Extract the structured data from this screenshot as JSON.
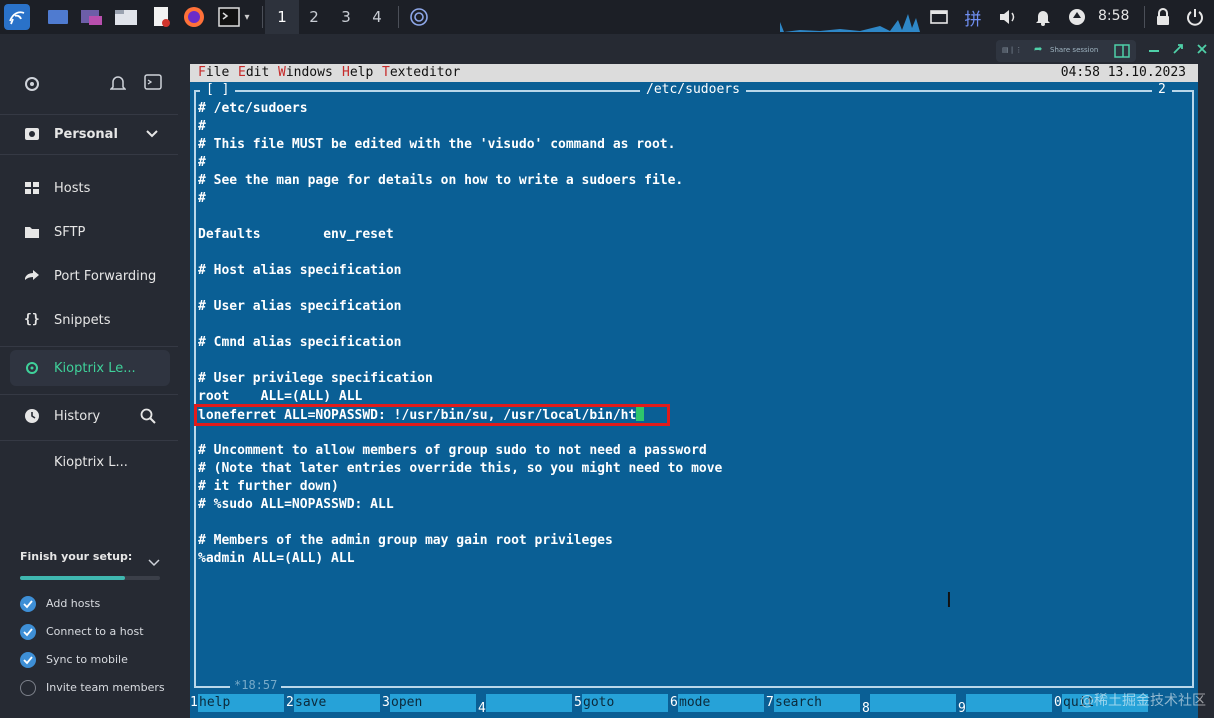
{
  "taskbar": {
    "workspaces": [
      "1",
      "2",
      "3",
      "4"
    ],
    "active_workspace": "1",
    "time": "8:58",
    "tray_icons": [
      "window-icon",
      "input-method-icon",
      "volume-icon",
      "bell-icon",
      "update-icon",
      "lock-icon",
      "power-icon"
    ],
    "input_method_glyph": "拼"
  },
  "sidebar": {
    "vault": "Personal",
    "items": [
      {
        "label": "Hosts",
        "icon": "hosts-icon"
      },
      {
        "label": "SFTP",
        "icon": "folder-icon"
      },
      {
        "label": "Port Forwarding",
        "icon": "forward-icon"
      },
      {
        "label": "Snippets",
        "icon": "braces-icon"
      }
    ],
    "active_session": "Kioptrix Le...",
    "history_label": "History",
    "history_items": [
      "Kioptrix L..."
    ],
    "setup": {
      "title": "Finish your setup:",
      "progress": 0.75,
      "steps": [
        {
          "label": "Add hosts",
          "done": true
        },
        {
          "label": "Connect to a host",
          "done": true
        },
        {
          "label": "Sync to mobile",
          "done": true
        },
        {
          "label": "Invite team members",
          "done": false
        }
      ]
    }
  },
  "session_bar": {
    "share_label": "Share session"
  },
  "terminal": {
    "menu": [
      {
        "hot": "F",
        "rest": "ile"
      },
      {
        "hot": "E",
        "rest": "dit"
      },
      {
        "hot": "W",
        "rest": "indows"
      },
      {
        "hot": "H",
        "rest": "elp"
      },
      {
        "hot": "T",
        "rest": "exteditor"
      }
    ],
    "clock": "04:58 13.10.2023",
    "frame_left": "[ ]",
    "file_title": "/etc/sudoers",
    "window_number": "2",
    "lines": [
      "# /etc/sudoers",
      "#",
      "# This file MUST be edited with the 'visudo' command as root.",
      "#",
      "# See the man page for details on how to write a sudoers file.",
      "#",
      "",
      "Defaults        env_reset",
      "",
      "# Host alias specification",
      "",
      "# User alias specification",
      "",
      "# Cmnd alias specification",
      "",
      "# User privilege specification",
      "root    ALL=(ALL) ALL",
      "loneferret ALL=NOPASSWD: !/usr/bin/su, /usr/local/bin/ht",
      "",
      "# Uncomment to allow members of group sudo to not need a password",
      "# (Note that later entries override this, so you might need to move",
      "# it further down)",
      "# %sudo ALL=NOPASSWD: ALL",
      "",
      "# Members of the admin group may gain root privileges",
      "%admin ALL=(ALL) ALL"
    ],
    "cursor_position": "*18:57",
    "function_keys": [
      {
        "num": "1",
        "name": "help"
      },
      {
        "num": "2",
        "name": "save"
      },
      {
        "num": "3",
        "name": "open"
      },
      {
        "num": "4",
        "name": ""
      },
      {
        "num": "5",
        "name": "goto"
      },
      {
        "num": "6",
        "name": "mode"
      },
      {
        "num": "7",
        "name": "search"
      },
      {
        "num": "8",
        "name": ""
      },
      {
        "num": "9",
        "name": ""
      },
      {
        "num": "0",
        "name": "quit"
      }
    ],
    "watermark": "@稀土掘金技术社区"
  },
  "colors": {
    "terminal_bg": "#0a5f95",
    "menubar_bg": "#dcdcdc",
    "highlight": "#e11b1b",
    "fkey_bg": "#26a2d8",
    "accent_green": "#3fb7b0"
  }
}
